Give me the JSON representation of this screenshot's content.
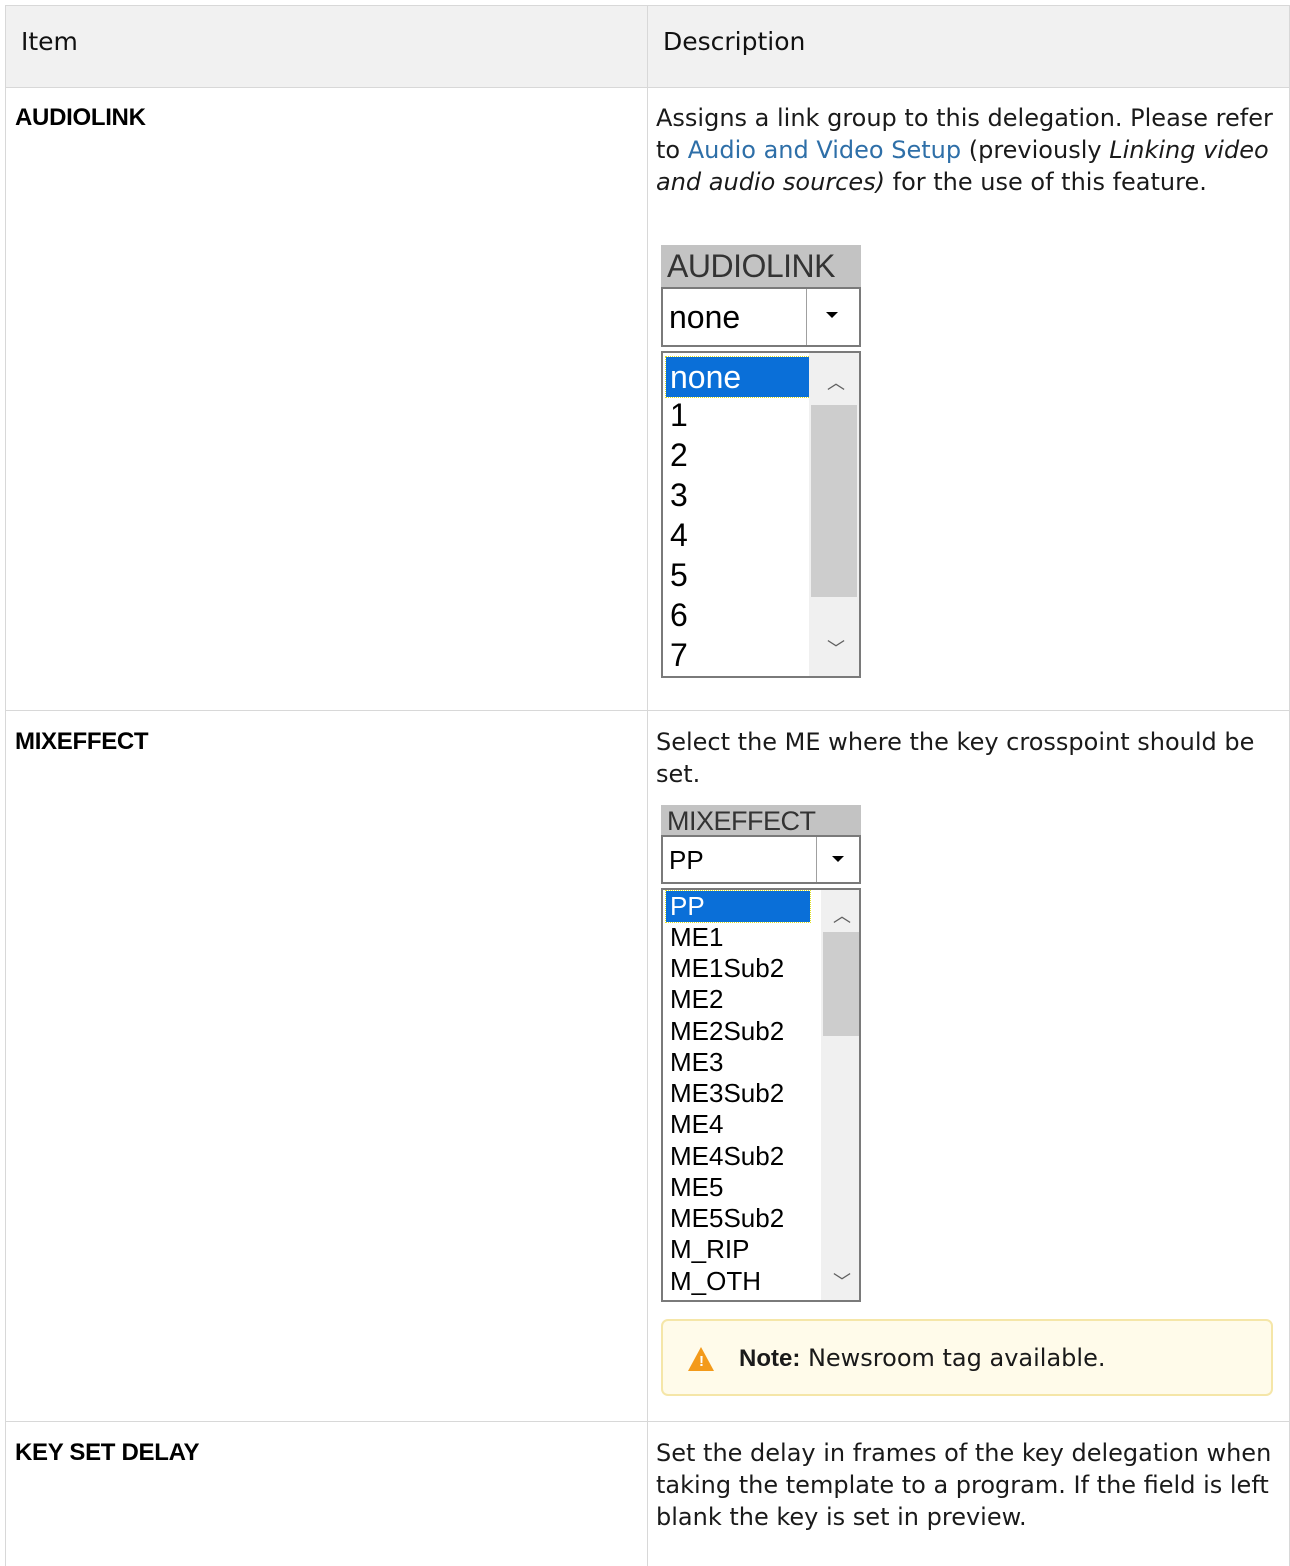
{
  "table": {
    "headers": {
      "item": "Item",
      "description": "Description"
    },
    "rows": [
      {
        "item": "AUDIOLINK",
        "description_parts": {
          "p1": "Assigns a link group to this delegation. Please refer to ",
          "link": "Audio and Video Setup",
          "p2": " (previously ",
          "italic": "Linking video and audio sources)",
          "p3": " for the use of this feature."
        },
        "widget": {
          "title": "AUDIOLINK",
          "selected": "none",
          "options": [
            "none",
            "1",
            "2",
            "3",
            "4",
            "5",
            "6",
            "7"
          ]
        }
      },
      {
        "item": "MIXEFFECT",
        "description": "Select the ME where the key crosspoint should be set.",
        "widget": {
          "title": "MIXEFFECT",
          "selected": "PP",
          "options": [
            "PP",
            "ME1",
            "ME1Sub2",
            "ME2",
            "ME2Sub2",
            "ME3",
            "ME3Sub2",
            "ME4",
            "ME4Sub2",
            "ME5",
            "ME5Sub2",
            "M_RIP",
            "M_OTH"
          ]
        },
        "note": {
          "label": "Note:",
          "text": " Newsroom tag available."
        }
      },
      {
        "item": "KEY SET DELAY",
        "description": "Set the delay in frames of the key delegation when taking the template to a program. If the field is left blank the key is set in preview."
      }
    ]
  },
  "colors": {
    "link": "#2e6fa8",
    "selection": "#0a6fd8",
    "warning": "#f39a1a"
  },
  "icons": {
    "note": "warning-icon",
    "dropdown": "chevron-down-icon",
    "scroll_up": "chevron-up-icon",
    "scroll_down": "chevron-down-icon"
  }
}
